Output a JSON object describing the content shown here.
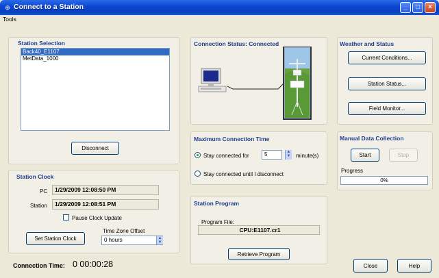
{
  "window": {
    "title": "Connect to a Station"
  },
  "menu": {
    "tools": "Tools"
  },
  "station_selection": {
    "title": "Station Selection",
    "items": [
      "Back40_E1107",
      "MetData_1000"
    ],
    "selected_index": 0,
    "disconnect_label": "Disconnect"
  },
  "station_clock": {
    "title": "Station Clock",
    "pc_label": "PC",
    "pc_value": "1/29/2009 12:08:50 PM",
    "station_label": "Station",
    "station_value": "1/29/2009 12:08:51 PM",
    "pause_label": "Pause Clock Update",
    "set_label": "Set Station Clock",
    "tz_label": "Time Zone Offset",
    "tz_value": "0 hours"
  },
  "connection_time": {
    "label": "Connection Time:",
    "value": "0 00:00:28"
  },
  "connection_status": {
    "title": "Connection Status: Connected"
  },
  "max_connection": {
    "title": "Maximum Connection Time",
    "stay_for_label": "Stay connected for",
    "minutes_value": "5",
    "minutes_unit": "minute(s)",
    "stay_until_label": "Stay connected until I disconnect"
  },
  "station_program": {
    "title": "Station Program",
    "file_label": "Program File:",
    "file_value": "CPU:E1107.cr1",
    "retrieve_label": "Retrieve Program"
  },
  "weather": {
    "title": "Weather and Status",
    "current_label": "Current Conditions...",
    "status_label": "Station Status...",
    "field_label": "Field Monitor..."
  },
  "manual": {
    "title": "Manual Data Collection",
    "start_label": "Start",
    "stop_label": "Stop",
    "progress_label": "Progress",
    "progress_text": "0%",
    "progress_value": 0
  },
  "footer": {
    "close_label": "Close",
    "help_label": "Help"
  },
  "colors": {
    "title_blue": "#0a46d0",
    "group_title": "#1e3c8c",
    "selection": "#316ac5"
  }
}
